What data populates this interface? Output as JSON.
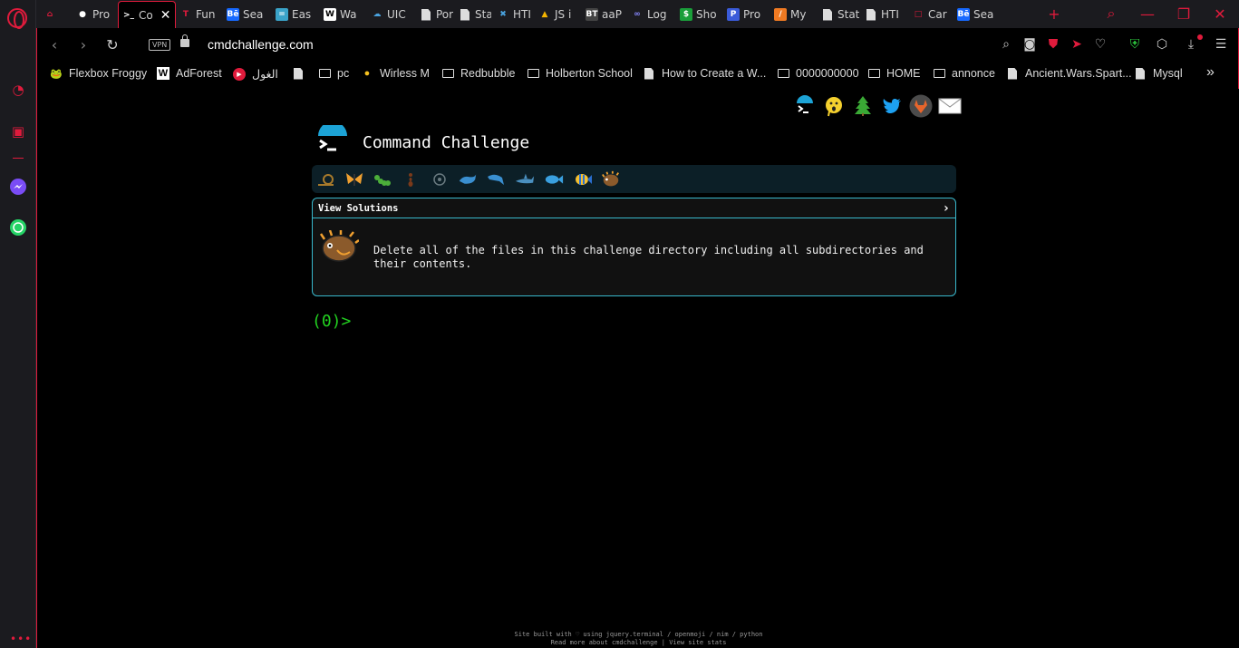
{
  "browser": {
    "tabs": [
      {
        "label": "",
        "icon": "gamepad-icon",
        "fav_bg": "",
        "fav_color": "#e01b3c",
        "fav_text": "⌂"
      },
      {
        "label": "Pro",
        "icon": "github-icon",
        "fav_bg": "",
        "fav_color": "#ffffff",
        "fav_text": "●"
      },
      {
        "label": "Co",
        "icon": "terminal-icon",
        "fav_bg": "",
        "fav_color": "#ffffff",
        "fav_text": ">_",
        "active": true
      },
      {
        "label": "Fun",
        "icon": "tesla-icon",
        "fav_bg": "",
        "fav_color": "#e01b3c",
        "fav_text": "T"
      },
      {
        "label": "Sea",
        "icon": "behance-icon",
        "fav_bg": "#1769ff",
        "fav_color": "#ffffff",
        "fav_text": "Bē"
      },
      {
        "label": "Eas",
        "icon": "easy-icon",
        "fav_bg": "#3aa3c9",
        "fav_color": "#ffffff",
        "fav_text": "="
      },
      {
        "label": "Wa",
        "icon": "wl-icon",
        "fav_bg": "#ffffff",
        "fav_color": "#000000",
        "fav_text": "W"
      },
      {
        "label": "UIC",
        "icon": "cloud-icon",
        "fav_bg": "",
        "fav_color": "#4aa3df",
        "fav_text": "☁"
      },
      {
        "label": "Por",
        "icon": "page-icon",
        "fav_bg": "#dddddd",
        "fav_color": "#dddddd",
        "fav_text": ""
      },
      {
        "label": "Stat",
        "icon": "page-icon",
        "fav_bg": "#dddddd",
        "fav_color": "#dddddd",
        "fav_text": ""
      },
      {
        "label": "HTI",
        "icon": "vscode-icon",
        "fav_bg": "",
        "fav_color": "#4aa3df",
        "fav_text": "✖"
      },
      {
        "label": "JS i",
        "icon": "drive-icon",
        "fav_bg": "",
        "fav_color": "#f4b400",
        "fav_text": "▲"
      },
      {
        "label": "aaP",
        "icon": "bt-icon",
        "fav_bg": "#444444",
        "fav_color": "#ffffff",
        "fav_text": "BT"
      },
      {
        "label": "Log",
        "icon": "infinity-icon",
        "fav_bg": "",
        "fav_color": "#8888ff",
        "fav_text": "∞"
      },
      {
        "label": "Sho",
        "icon": "dollar-icon",
        "fav_bg": "#1a9e3a",
        "fav_color": "#ffffff",
        "fav_text": "$"
      },
      {
        "label": "Pro",
        "icon": "p-icon",
        "fav_bg": "#3a5bd9",
        "fav_color": "#ffffff",
        "fav_text": "P"
      },
      {
        "label": "My",
        "icon": "my-icon",
        "fav_bg": "#f07a22",
        "fav_color": "#ffffff",
        "fav_text": "/"
      },
      {
        "label": "Stat",
        "icon": "page-icon",
        "fav_bg": "#dddddd",
        "fav_color": "#dddddd",
        "fav_text": ""
      },
      {
        "label": "HTI",
        "icon": "page-icon",
        "fav_bg": "#dddddd",
        "fav_color": "#dddddd",
        "fav_text": ""
      },
      {
        "label": "Car",
        "icon": "card-icon",
        "fav_bg": "",
        "fav_color": "#e01b3c",
        "fav_text": "□"
      },
      {
        "label": "Sea",
        "icon": "behance-icon",
        "fav_bg": "#1769ff",
        "fav_color": "#ffffff",
        "fav_text": "Bē"
      }
    ],
    "url": "cmdchallenge.com",
    "vpn_label": "VPN",
    "bookmarks": [
      {
        "label": "Flexbox Froggy",
        "kind": "frog"
      },
      {
        "label": "AdForest",
        "kind": "ad"
      },
      {
        "label": "الغول",
        "kind": "youtube"
      },
      {
        "label": "",
        "kind": "page"
      },
      {
        "label": "pc",
        "kind": "folder"
      },
      {
        "label": "Wirless M",
        "kind": "coin"
      },
      {
        "label": "Redbubble",
        "kind": "folder"
      },
      {
        "label": "Holberton School",
        "kind": "folder"
      },
      {
        "label": "How to Create a W...",
        "kind": "page"
      },
      {
        "label": "0000000000",
        "kind": "folder"
      },
      {
        "label": "HOME",
        "kind": "folder"
      },
      {
        "label": "annonce",
        "kind": "folder"
      },
      {
        "label": "Ancient.Wars.Spart...",
        "kind": "page"
      },
      {
        "label": "Mysql",
        "kind": "page"
      }
    ]
  },
  "page": {
    "title": "Command Challenge",
    "view_solutions_label": "View Solutions",
    "view_solutions_arrow": "›",
    "challenge_text": "Delete all of the files in this challenge directory including all subdirectories and their contents.",
    "prompt": "(0)>",
    "footer_line1": "Site built with ♡ using jquery.terminal / openmoji / nim / python",
    "footer_line2": "Read more about cmdchallenge | View site stats",
    "badges": [
      "snail",
      "butterfly",
      "caterpillar",
      "ant",
      "lock-badge",
      "whale",
      "dolphin",
      "shark",
      "fish",
      "tropical-fish",
      "pufferfish"
    ],
    "social": [
      "terminal-logo",
      "emoji-face",
      "tree",
      "twitter",
      "gitlab",
      "mail"
    ]
  },
  "colors": {
    "accent": "#e01b3c",
    "card_border": "#38b8cc",
    "prompt_green": "#22d020",
    "badge_bar": "#0c1f27"
  }
}
